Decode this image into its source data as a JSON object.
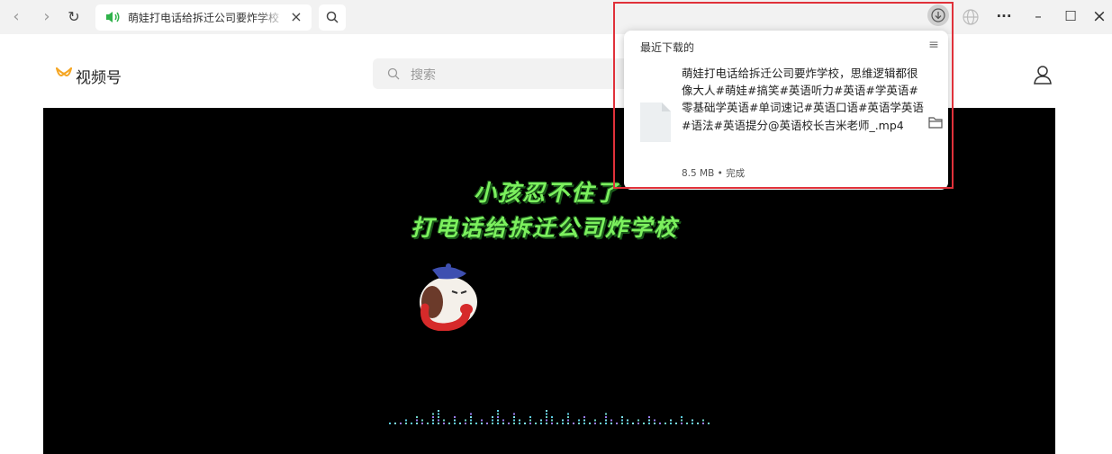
{
  "browser": {
    "nav": {
      "back": "‹",
      "forward": "›",
      "reload": "↻"
    },
    "tab": {
      "title": "萌娃打电话给拆迁公司要炸学校",
      "close": "×",
      "icon": "speaker-icon"
    },
    "window": {
      "more": "···",
      "minimize": "–",
      "maximize": "☐",
      "close": "×"
    }
  },
  "app": {
    "name": "视频号",
    "search_placeholder": "搜索",
    "accent": "#f5a623"
  },
  "video": {
    "caption_line1": "小孩忍不住了",
    "caption_line2": "打电话给拆迁公司炸学校"
  },
  "downloads": {
    "heading": "最近下载的",
    "menu": "≡",
    "item": {
      "name": "萌娃打电话给拆迁公司要炸学校，思维逻辑都很像大人#萌娃#搞笑#英语听力#英语#学英语#零基础学英语#单词速记#英语口语#英语学英语#语法#英语提分@英语校长吉米老师_.mp4",
      "meta": "8.5 MB • 完成"
    }
  }
}
